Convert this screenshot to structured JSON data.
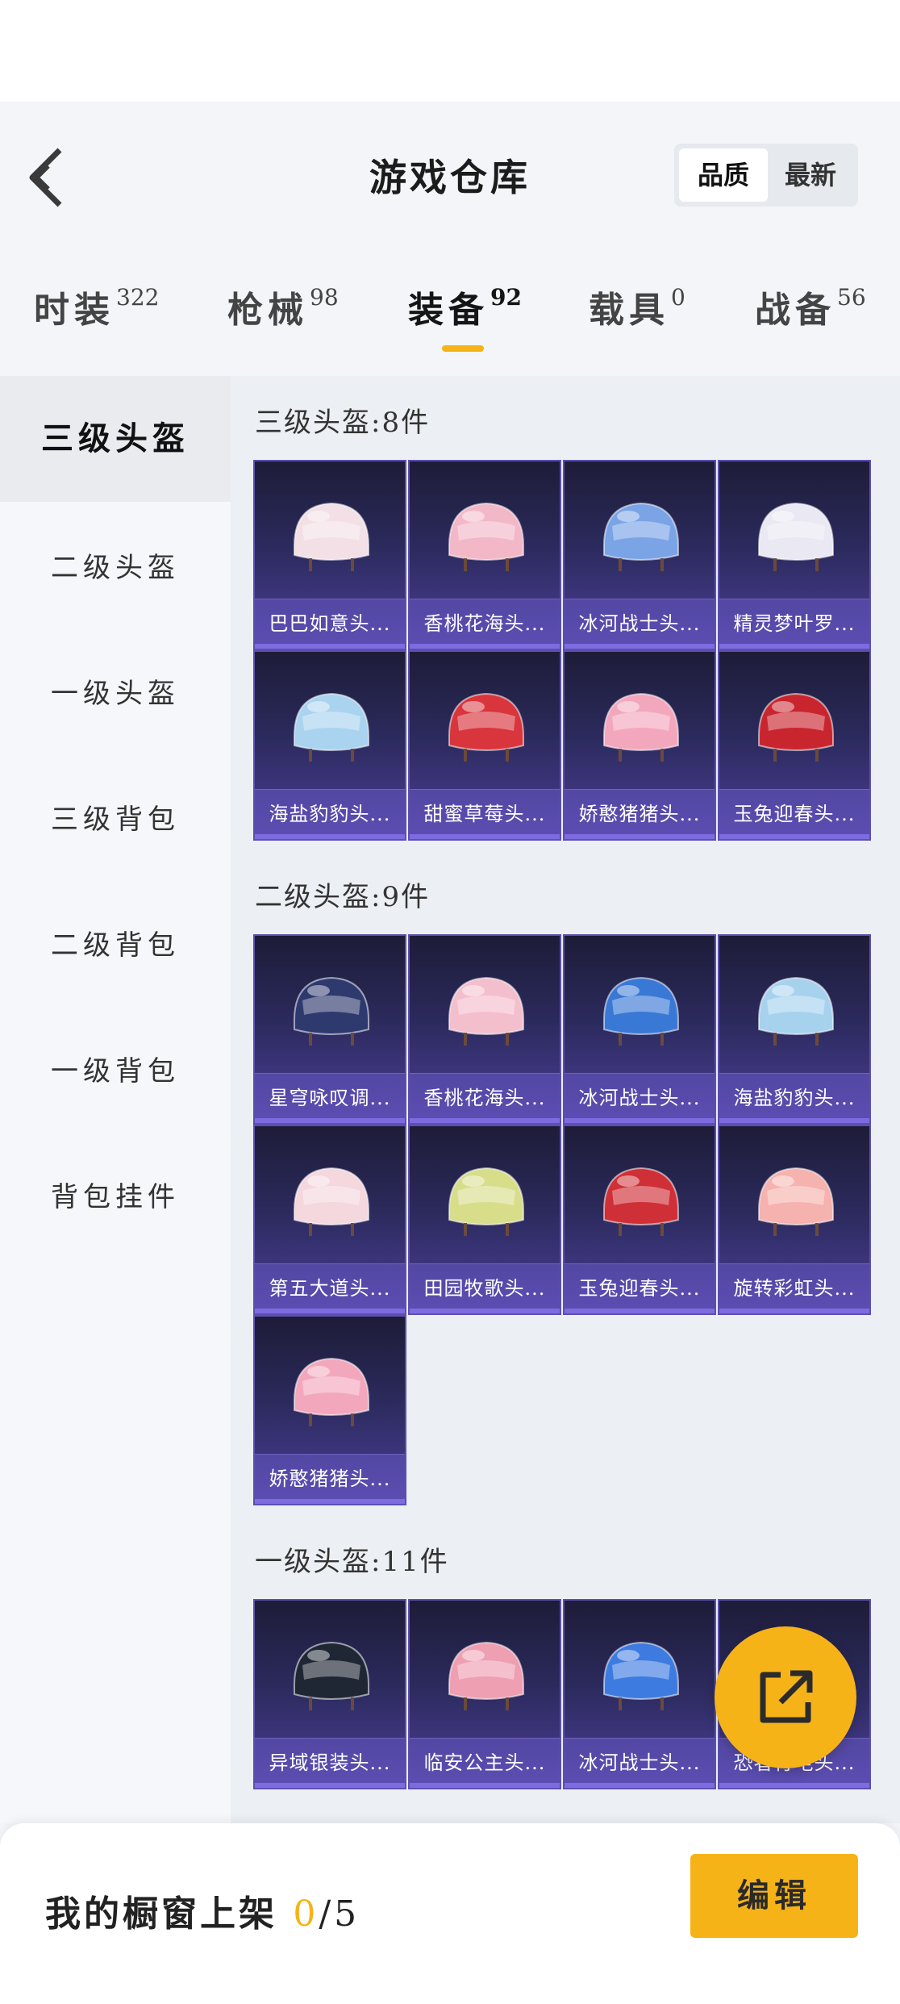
{
  "header": {
    "title": "游戏仓库",
    "sort": {
      "active": "品质",
      "inactive": "最新"
    }
  },
  "categories": [
    {
      "label": "时装",
      "count": "322"
    },
    {
      "label": "枪械",
      "count": "98"
    },
    {
      "label": "装备",
      "count": "92"
    },
    {
      "label": "载具",
      "count": "0"
    },
    {
      "label": "战备",
      "count": "56"
    }
  ],
  "sidebar": {
    "items": [
      "三级头盔",
      "二级头盔",
      "一级头盔",
      "三级背包",
      "二级背包",
      "一级背包",
      "背包挂件"
    ]
  },
  "sections": [
    {
      "title": "三级头盔:8件",
      "items": [
        {
          "name": "巴巴如意头...",
          "color": "#f3e0e6"
        },
        {
          "name": "香桃花海头...",
          "color": "#f2b8c8"
        },
        {
          "name": "冰河战士头...",
          "color": "#7aa4e6"
        },
        {
          "name": "精灵梦叶罗...",
          "color": "#eae8f2"
        },
        {
          "name": "海盐豹豹头...",
          "color": "#a9d3ee"
        },
        {
          "name": "甜蜜草莓头...",
          "color": "#d8353d"
        },
        {
          "name": "娇憨猪猪头...",
          "color": "#f3a7bd"
        },
        {
          "name": "玉兔迎春头...",
          "color": "#c9252e"
        }
      ]
    },
    {
      "title": "二级头盔:9件",
      "items": [
        {
          "name": "星穹咏叹调...",
          "color": "#2e3a6e"
        },
        {
          "name": "香桃花海头...",
          "color": "#f4bfcd"
        },
        {
          "name": "冰河战士头...",
          "color": "#3a78d6"
        },
        {
          "name": "海盐豹豹头...",
          "color": "#a6d2ee"
        },
        {
          "name": "第五大道头...",
          "color": "#f5d7de"
        },
        {
          "name": "田园牧歌头...",
          "color": "#d8dd8a"
        },
        {
          "name": "玉兔迎春头...",
          "color": "#cf2f36"
        },
        {
          "name": "旋转彩虹头...",
          "color": "#f6b2ae"
        },
        {
          "name": "娇憨猪猪头...",
          "color": "#f3a7bd"
        }
      ]
    },
    {
      "title": "一级头盔:11件",
      "items": [
        {
          "name": "异域银装头...",
          "color": "#202734"
        },
        {
          "name": "临安公主头...",
          "color": "#ef9fb2"
        },
        {
          "name": "冰河战士头...",
          "color": "#3e7be0"
        },
        {
          "name": "恐者行屯头...",
          "color": "#2b2a55"
        }
      ]
    }
  ],
  "footer": {
    "label": "我的橱窗上架",
    "count": "0",
    "total": "/5",
    "edit_button": "编辑"
  },
  "colors": {
    "accent": "#f6b318",
    "card_top": "#1d1c38",
    "card_bottom": "#4c3f99"
  }
}
